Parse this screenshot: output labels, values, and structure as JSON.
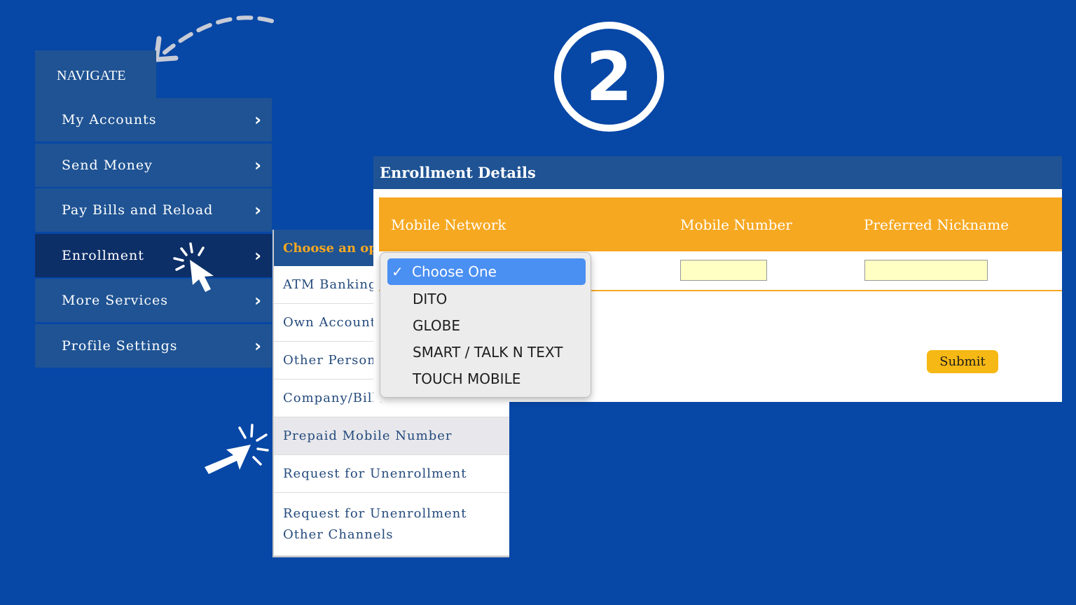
{
  "step_number": "2",
  "nav": {
    "title": "NAVIGATE",
    "items": [
      {
        "label": "My Accounts"
      },
      {
        "label": "Send Money"
      },
      {
        "label": "Pay Bills and Reload"
      },
      {
        "label": "Enrollment"
      },
      {
        "label": "More Services"
      },
      {
        "label": "Profile Settings"
      }
    ],
    "active_index": 3
  },
  "submenu": {
    "header": "Choose an option",
    "items": [
      {
        "label": "ATM Banking"
      },
      {
        "label": "Own Account"
      },
      {
        "label": "Other Person's"
      },
      {
        "label": "Company/Biller"
      },
      {
        "label": "Prepaid Mobile Number"
      },
      {
        "label": "Request for Unenrollment"
      },
      {
        "label": "Request for Unenrollment Other Channels"
      }
    ],
    "active_index": 4
  },
  "enrollment": {
    "title": "Enrollment Details",
    "columns": [
      "Mobile Network",
      "Mobile Number",
      "Preferred Nickname"
    ],
    "mobile_number_value": "",
    "nickname_value": "",
    "submit_label": "Submit"
  },
  "dropdown": {
    "selected": "Choose One",
    "options": [
      "DITO",
      "GLOBE",
      "SMART / TALK N TEXT",
      "TOUCH MOBILE"
    ]
  },
  "colors": {
    "background": "#0747a6",
    "panel_blue": "#1f5393",
    "active_blue": "#0d2f67",
    "orange": "#f6a821",
    "input_yellow": "#ffffc4",
    "select_blue": "#4a8ff2"
  },
  "icons": [
    "chevron-right-icon",
    "pointer-click-icon",
    "dashed-arrow-icon",
    "checkmark-icon"
  ]
}
